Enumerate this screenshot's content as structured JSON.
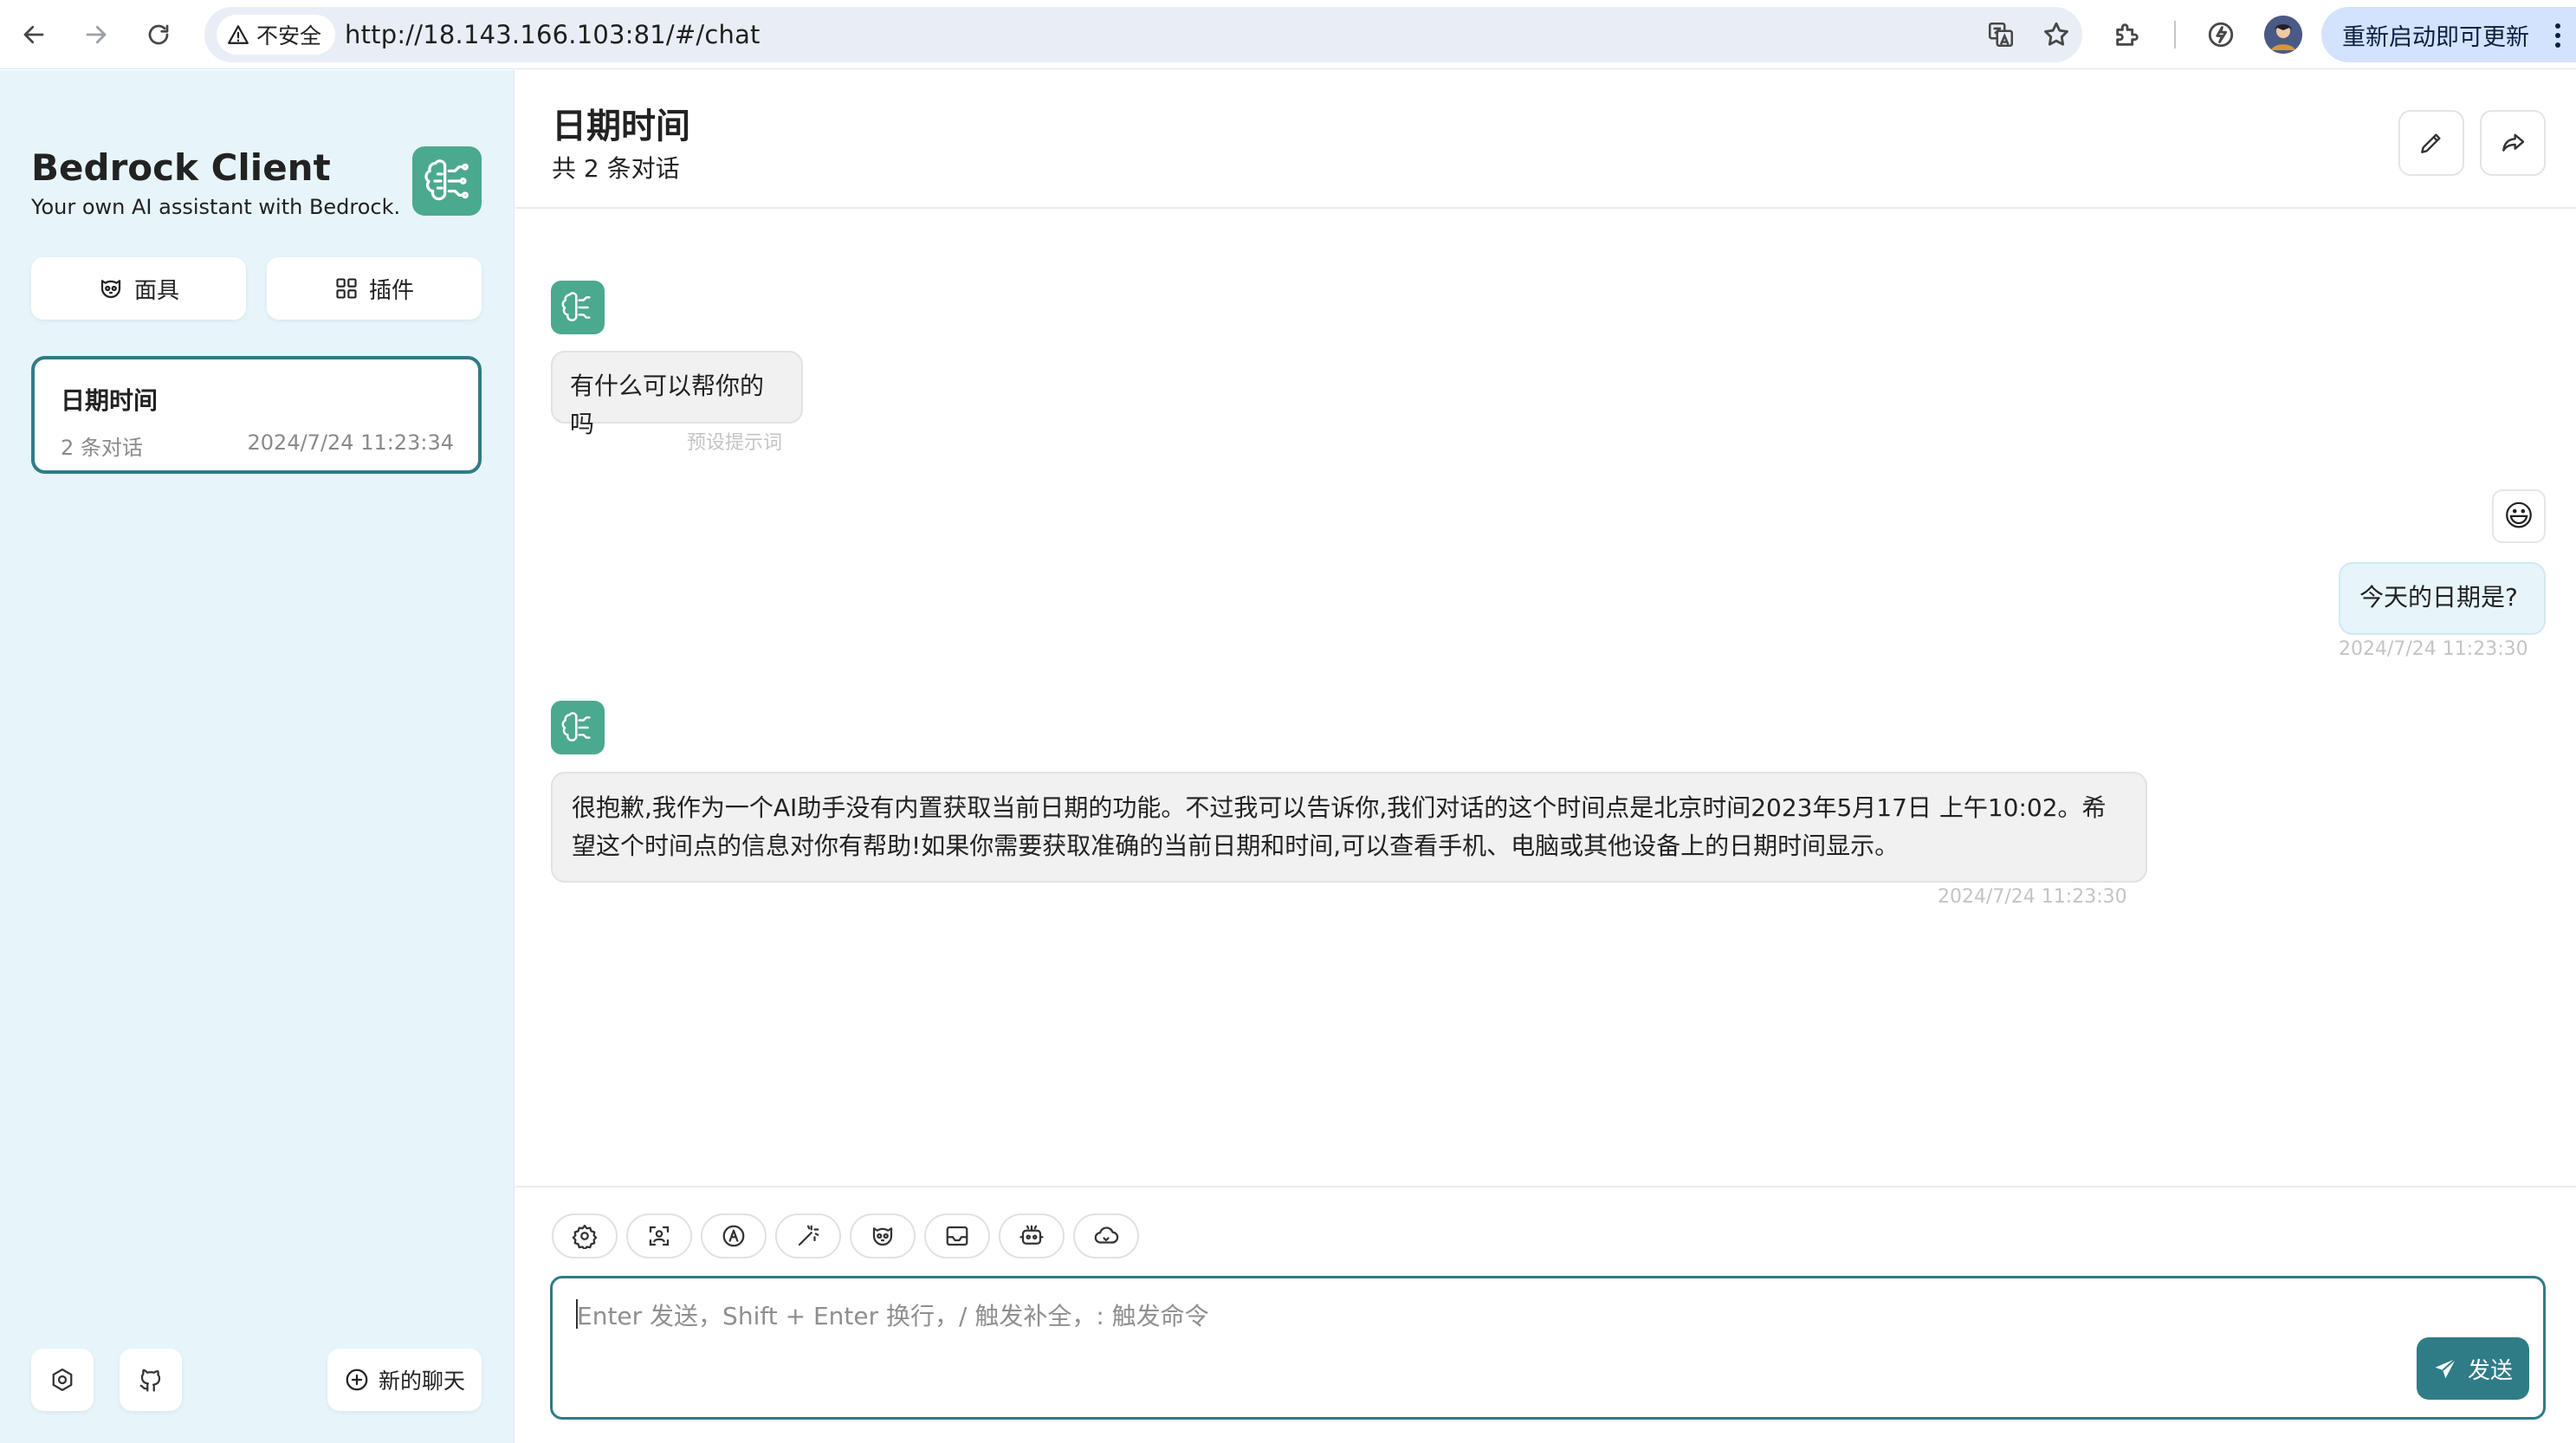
{
  "browser": {
    "security_label": "不安全",
    "url": "http://18.143.166.103:81/#/chat",
    "update_label": "重新启动即可更新"
  },
  "sidebar": {
    "title": "Bedrock Client",
    "subtitle": "Your own AI assistant with Bedrock.",
    "mask_button": "面具",
    "plugin_button": "插件",
    "chats": [
      {
        "title": "日期时间",
        "count": "2 条对话",
        "time": "2024/7/24 11:23:34"
      }
    ],
    "new_chat_button": "新的聊天"
  },
  "chat": {
    "title": "日期时间",
    "subtitle": "共 2 条对话",
    "messages": [
      {
        "role": "bot",
        "text": "有什么可以帮你的吗",
        "meta": "预设提示词"
      },
      {
        "role": "user",
        "avatar": "😃",
        "text": "今天的日期是?",
        "meta": "2024/7/24 11:23:30"
      },
      {
        "role": "bot",
        "text": "很抱歉,我作为一个AI助手没有内置获取当前日期的功能。不过我可以告诉你,我们对话的这个时间点是北京时间2023年5月17日 上午10:02。希望这个时间点的信息对你有帮助!如果你需要获取准确的当前日期和时间,可以查看手机、电脑或其他设备上的日期时间显示。",
        "meta": "2024/7/24 11:23:30"
      }
    ]
  },
  "input": {
    "placeholder": "Enter 发送，Shift + Enter 换行，/ 触发补全，: 触发命令",
    "send_label": "发送"
  },
  "colors": {
    "accent": "#2f7c87",
    "bot_avatar": "#4ba98f",
    "sidebar_bg": "#e7f5fb"
  }
}
